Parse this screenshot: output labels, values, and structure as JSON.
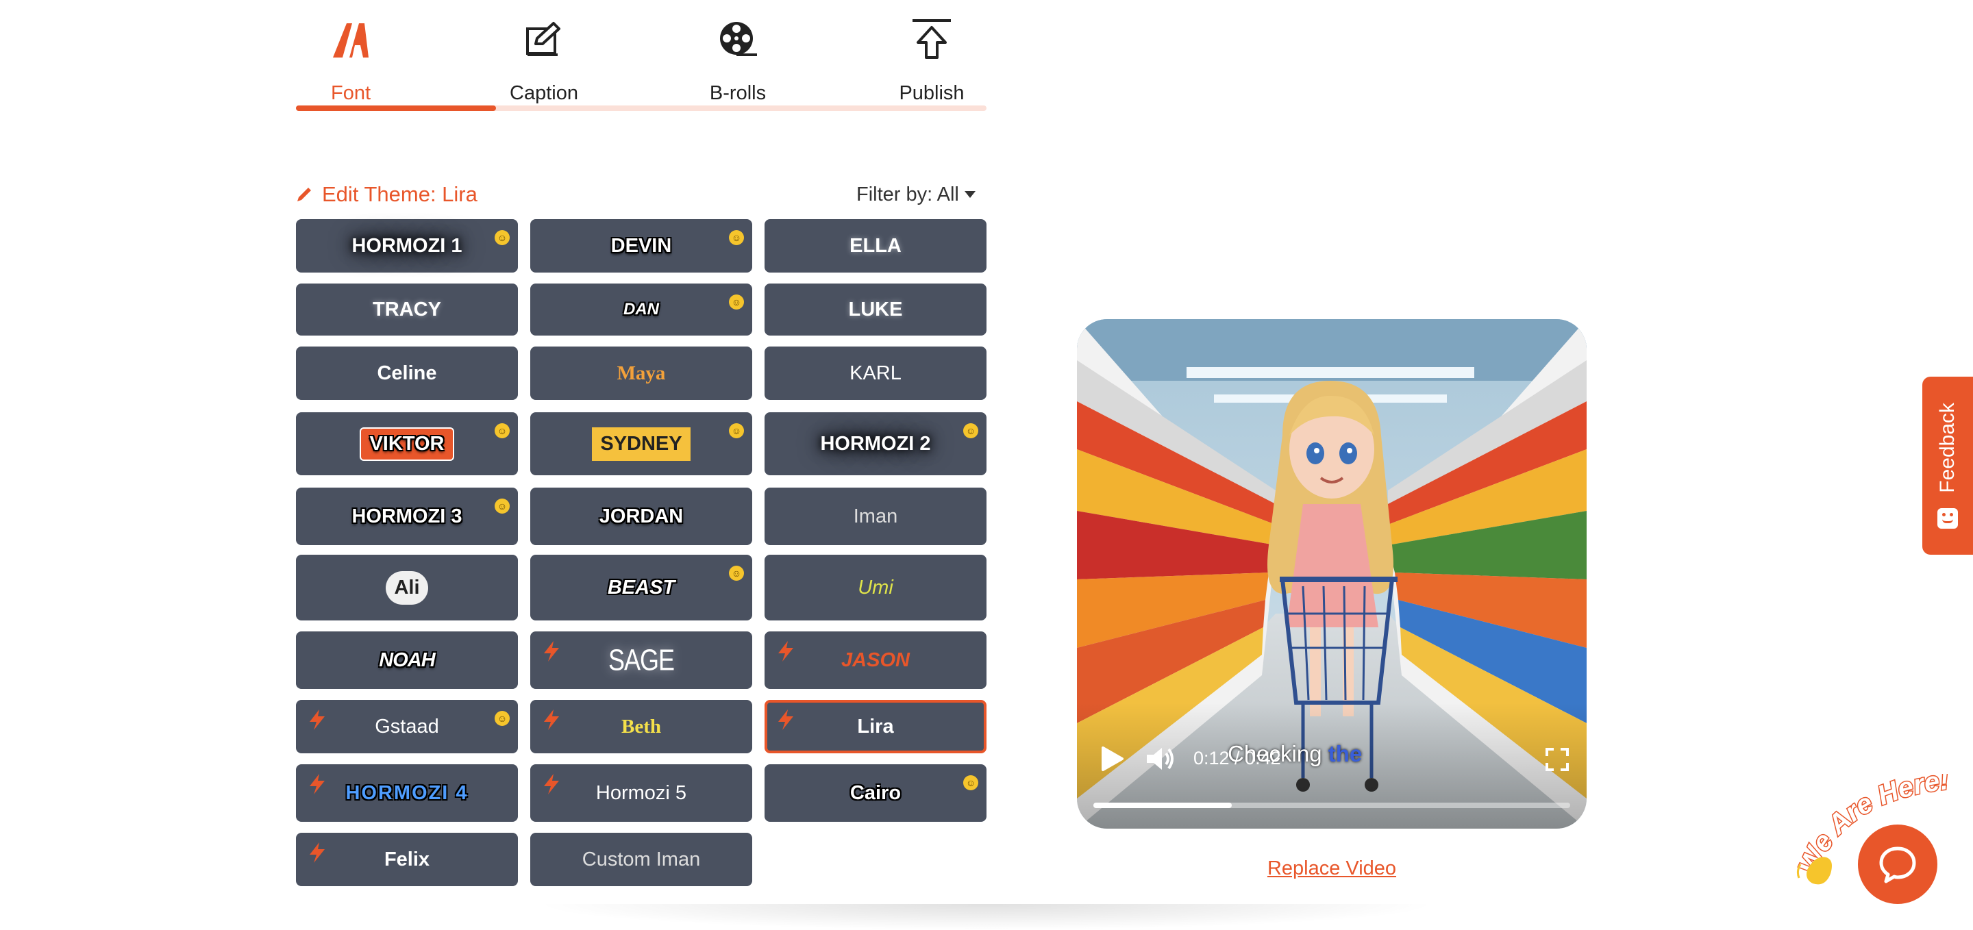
{
  "tabs": [
    {
      "label": "Font",
      "icon": "font-logo-icon",
      "active": true
    },
    {
      "label": "Caption",
      "icon": "edit-square-icon",
      "active": false
    },
    {
      "label": "B-rolls",
      "icon": "film-reel-icon",
      "active": false
    },
    {
      "label": "Publish",
      "icon": "upload-icon",
      "active": false
    }
  ],
  "tab_progress": 0.29,
  "edit_theme": "Edit Theme: Lira",
  "filter_label": "Filter by: All",
  "themes": [
    {
      "label": "HORMOZI 1",
      "emoji": true
    },
    {
      "label": "DEVIN",
      "emoji": true
    },
    {
      "label": "ELLA"
    },
    {
      "label": "TRACY"
    },
    {
      "label": "DAN",
      "emoji": true
    },
    {
      "label": "LUKE"
    },
    {
      "label": "Celine"
    },
    {
      "label": "Maya"
    },
    {
      "label": "KARL"
    },
    {
      "label": "VIKTOR",
      "emoji": true
    },
    {
      "label": "SYDNEY",
      "emoji": true
    },
    {
      "label": "HORMOZI 2",
      "emoji": true
    },
    {
      "label": "HORMOZI 3",
      "emoji": true
    },
    {
      "label": "JORDAN"
    },
    {
      "label": "Iman"
    },
    {
      "label": "Ali"
    },
    {
      "label": "BEAST",
      "emoji": true
    },
    {
      "label": "Umi"
    },
    {
      "label": "NOAH"
    },
    {
      "label": "SAGE",
      "bolt": true
    },
    {
      "label": "JASON",
      "bolt": true
    },
    {
      "label": "Gstaad",
      "bolt": true,
      "emoji": true
    },
    {
      "label": "Beth",
      "bolt": true
    },
    {
      "label": "Lira",
      "bolt": true,
      "selected": true
    },
    {
      "label": "HORMOZI 4",
      "bolt": true
    },
    {
      "label": "Hormozi 5",
      "bolt": true
    },
    {
      "label": "Cairo",
      "emoji": true
    },
    {
      "label": "Felix",
      "bolt": true
    },
    {
      "label": "Custom Iman"
    }
  ],
  "video": {
    "caption_word_1": "Checking",
    "caption_word_2": "the",
    "time": "0:12 / 0:42",
    "progress": 0.29
  },
  "replace_video": "Replace Video",
  "feedback": "Feedback",
  "we_are_here": "We Are Here!",
  "colors": {
    "accent": "#e8562a",
    "card": "#4a5160"
  }
}
